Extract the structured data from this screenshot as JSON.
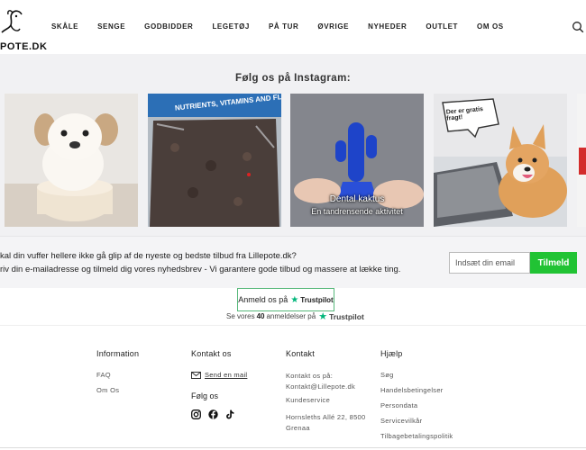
{
  "header": {
    "logo_text": "POTE.DK",
    "nav": [
      "SKÅLE",
      "SENGE",
      "GODBIDDER",
      "LEGETØJ",
      "PÅ TUR",
      "ØVRIGE",
      "NYHEDER",
      "OUTLET",
      "OM OS"
    ],
    "search_icon": "search-icon"
  },
  "instagram": {
    "title": "Følg os på Instagram:",
    "tiles": [
      {
        "caption": ""
      },
      {
        "caption": ""
      },
      {
        "caption_line1": "Dental kaktus",
        "caption_line2": "En tandrensende aktivitet"
      },
      {
        "bubble": "Der er gratis fragt!"
      },
      {
        "caption": ""
      }
    ]
  },
  "newsletter": {
    "line1": "kal din vuffer hellere ikke gå glip af de nyeste og bedste tilbud fra Lillepote.dk?",
    "line2": "riv din e-mailadresse og tilmeld dig vores nyhedsbrev - Vi garantere gode tilbud og massere at lække ting.",
    "placeholder": "Indsæt din email",
    "button": "Tilmeld",
    "button_color": "#21c334"
  },
  "trustpilot": {
    "button_prefix": "Anmeld os på",
    "brand": "Trustpilot",
    "reviews_prefix": "Se vores",
    "reviews_count": "40",
    "reviews_suffix": "anmeldelser på",
    "star_color": "#00b67a"
  },
  "footer": {
    "information": {
      "title": "Information",
      "links": [
        "FAQ",
        "Om Os"
      ]
    },
    "kontakt_os": {
      "title": "Kontakt os",
      "mail_link": "Send en mail",
      "follow_title": "Følg os"
    },
    "kontakt": {
      "title": "Kontakt",
      "email_label": "Kontakt os på:",
      "email": "Kontakt@Lillepote.dk",
      "service": "Kundeservice",
      "address_line1": "Hornsleths Allé 22, 8500",
      "address_line2": "Grenaa"
    },
    "hjaelp": {
      "title": "Hjælp",
      "links": [
        "Søg",
        "Handelsbetingelser",
        "Persondata",
        "Servicevilkår",
        "Tilbagebetalingspolitik"
      ]
    }
  }
}
